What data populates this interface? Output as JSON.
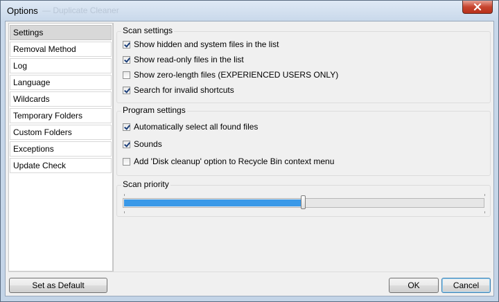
{
  "window": {
    "title": "Options",
    "title_ghost": "— Duplicate Cleaner"
  },
  "nav": {
    "items": [
      {
        "label": "Settings",
        "selected": true
      },
      {
        "label": "Removal Method",
        "selected": false
      },
      {
        "label": "Log",
        "selected": false
      },
      {
        "label": "Language",
        "selected": false
      },
      {
        "label": "Wildcards",
        "selected": false
      },
      {
        "label": "Temporary Folders",
        "selected": false
      },
      {
        "label": "Custom Folders",
        "selected": false
      },
      {
        "label": "Exceptions",
        "selected": false
      },
      {
        "label": "Update Check",
        "selected": false
      }
    ]
  },
  "scan_settings": {
    "title": "Scan settings",
    "options": [
      {
        "label": "Show hidden and system files in the list",
        "checked": true
      },
      {
        "label": "Show read-only files in the list",
        "checked": true
      },
      {
        "label": "Show zero-length files (EXPERIENCED USERS ONLY)",
        "checked": false
      },
      {
        "label": "Search for invalid shortcuts",
        "checked": true
      }
    ]
  },
  "program_settings": {
    "title": "Program settings",
    "options": [
      {
        "label": "Automatically select all found files",
        "checked": true
      },
      {
        "label": "Sounds",
        "checked": true
      },
      {
        "label": "Add 'Disk cleanup' option to Recycle Bin context menu",
        "checked": false
      }
    ]
  },
  "scan_priority": {
    "title": "Scan priority",
    "value_fraction": 0.5,
    "fill_color": "#3a99e8"
  },
  "buttons": {
    "set_default": "Set as Default",
    "ok": "OK",
    "cancel": "Cancel"
  },
  "icons": {
    "close": "close-icon"
  }
}
